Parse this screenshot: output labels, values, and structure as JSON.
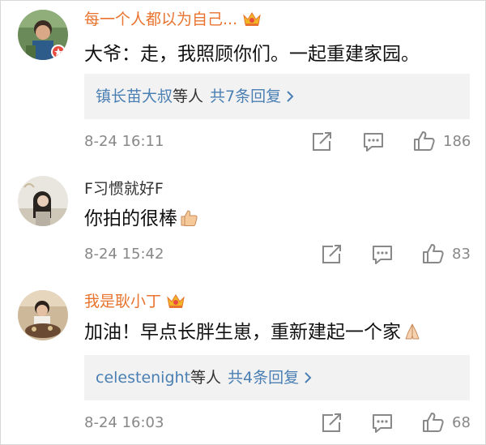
{
  "comments": [
    {
      "username": "每一个人都以为自己...",
      "vip": true,
      "text": "大爷：走，我照顾你们。一起重建家园。",
      "reply": {
        "names": "镇长苗大叔",
        "suffix": "等人",
        "count": "共7条回复"
      },
      "timestamp": "8-24 16:11",
      "likes": "186"
    },
    {
      "username": "F习惯就好F",
      "vip": false,
      "text": "你拍的很棒",
      "emoji": "thumbs-up-emoji",
      "timestamp": "8-24 15:42",
      "likes": "83"
    },
    {
      "username": "我是耿小丁",
      "vip": true,
      "text": "加油！早点长胖生崽，重新建起一个家",
      "emoji": "praying-hands-emoji",
      "reply": {
        "names": "celestenight",
        "suffix": "等人",
        "count": "共4条回复"
      },
      "timestamp": "8-24 16:03",
      "likes": "68"
    }
  ],
  "colors": {
    "vip_name": "#e8742f",
    "link": "#4a7fb4",
    "meta": "#888888",
    "reply_bg": "#f2f2f2"
  }
}
